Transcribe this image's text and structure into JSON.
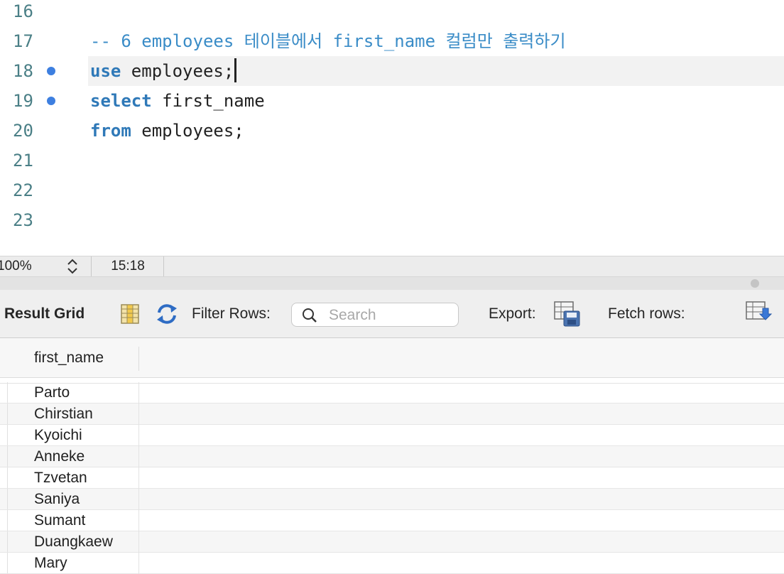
{
  "editor": {
    "lines": [
      {
        "number": "16",
        "parts": [],
        "breakpoint": false,
        "current": false
      },
      {
        "number": "17",
        "parts": [
          {
            "type": "comment",
            "text": "-- 6 employees 테이블에서 first_name 컬럼만 출력하기"
          }
        ],
        "breakpoint": false,
        "current": false
      },
      {
        "number": "18",
        "parts": [
          {
            "type": "kw",
            "text": "use"
          },
          {
            "type": "plain",
            "text": " employees;"
          }
        ],
        "breakpoint": true,
        "current": true
      },
      {
        "number": "19",
        "parts": [
          {
            "type": "kw",
            "text": "select"
          },
          {
            "type": "plain",
            "text": " first_name"
          }
        ],
        "breakpoint": true,
        "current": false
      },
      {
        "number": "20",
        "parts": [
          {
            "type": "kw",
            "text": "from"
          },
          {
            "type": "plain",
            "text": " employees;"
          }
        ],
        "breakpoint": false,
        "current": false
      },
      {
        "number": "21",
        "parts": [],
        "breakpoint": false,
        "current": false
      },
      {
        "number": "22",
        "parts": [],
        "breakpoint": false,
        "current": false
      },
      {
        "number": "23",
        "parts": [],
        "breakpoint": false,
        "current": false
      }
    ]
  },
  "statusbar": {
    "zoom": "100%",
    "cursor_position": "15:18"
  },
  "toolbar": {
    "result_grid_label": "Result Grid",
    "filter_rows_label": "Filter Rows:",
    "search_placeholder": "Search",
    "export_label": "Export:",
    "fetch_rows_label": "Fetch rows:"
  },
  "grid": {
    "columns": [
      "first_name"
    ],
    "rows": [
      "Parto",
      "Chirstian",
      "Kyoichi",
      "Anneke",
      "Tzvetan",
      "Saniya",
      "Sumant",
      "Duangkaew",
      "Mary"
    ]
  },
  "colors": {
    "keyword": "#2f79b8",
    "comment": "#3a8cc7",
    "line_number": "#4a7f86",
    "breakpoint": "#3d7fe0"
  },
  "icons": [
    "grid-view-icon",
    "refresh-icon",
    "search-icon",
    "export-icon",
    "fetch-rows-icon",
    "stepper-icon"
  ]
}
